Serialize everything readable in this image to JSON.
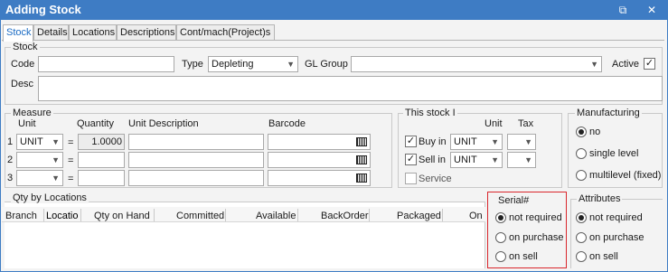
{
  "window": {
    "title": "Adding Stock",
    "restore_glyph": "⧉",
    "close_glyph": "✕"
  },
  "tabs": [
    "Stock",
    "Details",
    "Locations",
    "Descriptions",
    "Cont/mach(Project)s"
  ],
  "stock_group": {
    "title": "Stock",
    "code_label": "Code",
    "code_value": "",
    "type_label": "Type",
    "type_value": "Depleting",
    "gl_label": "GL Group",
    "gl_value": "",
    "active_label": "Active",
    "active_checked": true,
    "desc_label": "Desc",
    "desc_value": ""
  },
  "measure": {
    "title": "Measure",
    "unit_header": "Unit",
    "quantity_header": "Quantity",
    "unitdesc_header": "Unit Description",
    "barcode_header": "Barcode",
    "rows": [
      {
        "num": "1",
        "unit": "UNIT",
        "eq": "=",
        "qty": "1.0000"
      },
      {
        "num": "2",
        "unit": "",
        "eq": "=",
        "qty": ""
      },
      {
        "num": "3",
        "unit": "",
        "eq": "=",
        "qty": ""
      }
    ]
  },
  "this_stock": {
    "title": "This stock I",
    "unit_header": "Unit",
    "tax_header": "Tax",
    "buy_label": "Buy in",
    "buy_checked": true,
    "buy_unit": "UNIT",
    "sell_label": "Sell in",
    "sell_checked": true,
    "sell_unit": "UNIT",
    "service_label": "Service",
    "service_checked": false
  },
  "manufacturing": {
    "title": "Manufacturing",
    "options": [
      "no",
      "single level",
      "multilevel (fixed)"
    ],
    "selected": 0
  },
  "qty_by_locations": {
    "title": "Qty by Locations",
    "columns": [
      "Branch",
      "Locatio",
      "Qty on Hand",
      "Committed",
      "Available",
      "BackOrder",
      "Packaged",
      "On"
    ]
  },
  "serial": {
    "title": "Serial#",
    "options": [
      "not required",
      "on purchase",
      "on sell"
    ],
    "selected": 0,
    "highlight_color": "#d9262c"
  },
  "attributes": {
    "title": "Attributes",
    "options": [
      "not required",
      "on purchase",
      "on sell"
    ],
    "selected": 0
  }
}
